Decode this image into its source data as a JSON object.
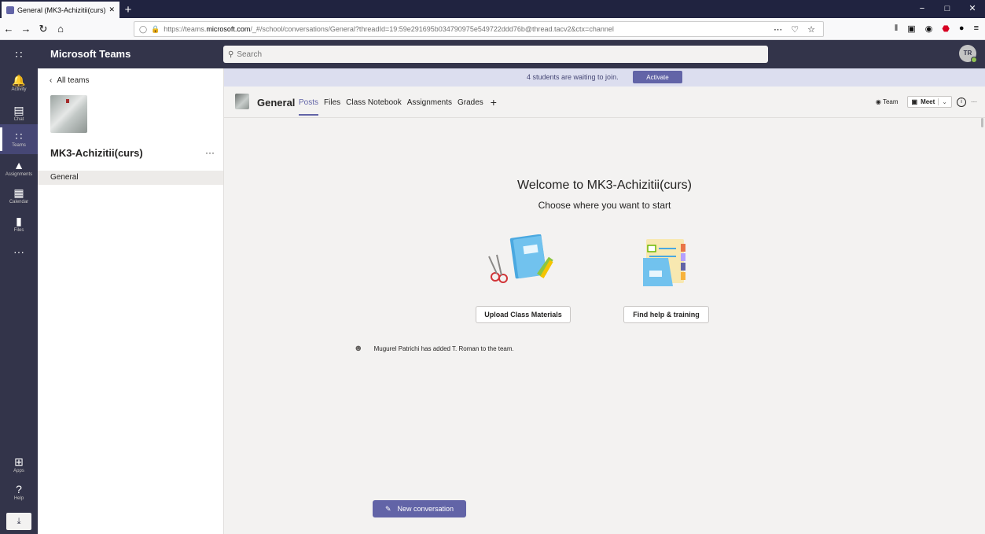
{
  "browser": {
    "tab_title": "General (MK3-Achizitii(curs)) | ​",
    "new_tab": "+",
    "url_prefix": "https://teams.",
    "url_domain": "microsoft.com",
    "url_rest": "/_#/school/conversations/General?threadId=19:59e291695b034790975e549722ddd76b@thread.tacv2&ctx=channel",
    "url_actions": "⋯ ♡ ☆",
    "win_minimize": "−",
    "win_maximize": "□",
    "win_close": "✕"
  },
  "header": {
    "app_name": "Microsoft Teams",
    "search_placeholder": "Search",
    "avatar_initials": "TR"
  },
  "rail": {
    "items": [
      {
        "label": "Activity",
        "icon": "bell-icon",
        "glyph": "🔔"
      },
      {
        "label": "Chat",
        "icon": "chat-icon",
        "glyph": "▤"
      },
      {
        "label": "Teams",
        "icon": "teams-icon",
        "glyph": "∷"
      },
      {
        "label": "Assignments",
        "icon": "assignments-icon",
        "glyph": "▲"
      },
      {
        "label": "Calendar",
        "icon": "calendar-icon",
        "glyph": "▦"
      },
      {
        "label": "Files",
        "icon": "files-icon",
        "glyph": "▮"
      }
    ],
    "more": "···",
    "apps": {
      "label": "Apps",
      "glyph": "⊞"
    },
    "help": {
      "label": "Help",
      "glyph": "?"
    },
    "download_glyph": "⤓"
  },
  "sidebar": {
    "back_label": "All teams",
    "team_name": "MK3-Achizitii(curs)",
    "more": "···",
    "channels": [
      "General"
    ]
  },
  "banner": {
    "text": "4 students are waiting to join.",
    "button": "Activate"
  },
  "channel_header": {
    "title": "General",
    "tabs": [
      "Posts",
      "Files",
      "Class Notebook",
      "Assignments",
      "Grades"
    ],
    "add": "+",
    "team_btn": "Team",
    "meet_btn": "Meet",
    "more": "···"
  },
  "main": {
    "welcome_title": "Welcome to MK3-Achizitii(curs)",
    "welcome_sub": "Choose where you want to start",
    "upload_btn": "Upload Class Materials",
    "help_btn": "Find help & training",
    "activity_text": "Mugurel Patrichi has added T. Roman to the team.",
    "new_conversation": "New conversation"
  },
  "colors": {
    "brand": "#6264a7",
    "header_bg": "#33344a",
    "banner_bg": "#dcdeef",
    "presence_available": "#92c353"
  }
}
